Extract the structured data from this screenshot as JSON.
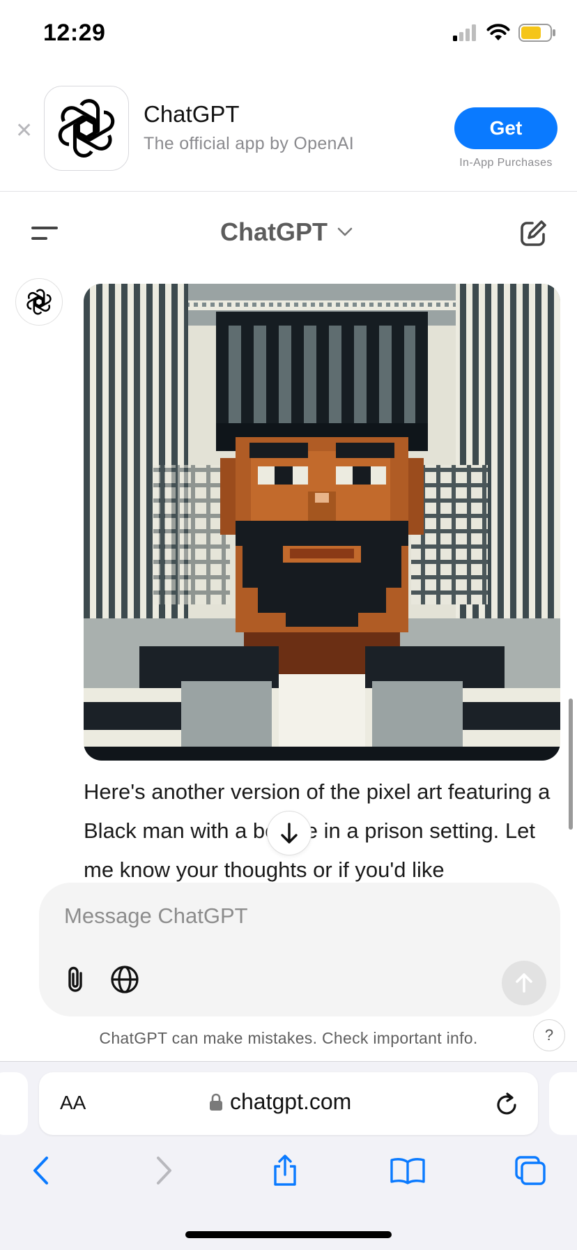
{
  "status_bar": {
    "time": "12:29",
    "signal_icon": "cellular-signal-icon",
    "wifi_icon": "wifi-icon",
    "battery_icon": "battery-icon",
    "battery_color": "#f5c518"
  },
  "app_banner": {
    "app_name": "ChatGPT",
    "subtitle": "The official app by OpenAI",
    "get_label": "Get",
    "in_app_label": "In-App Purchases",
    "accent_color": "#0a7aff"
  },
  "chat_header": {
    "title": "ChatGPT"
  },
  "conversation": {
    "assistant_text": "Here's another version of the pixel art featuring a Black man with a beanie in a prison setting. Let me know your thoughts or if you'd like"
  },
  "composer": {
    "placeholder": "Message ChatGPT",
    "disclaimer": "ChatGPT can make mistakes. Check important info.",
    "help_label": "?"
  },
  "safari": {
    "text_size_label": "AA",
    "url": "chatgpt.com"
  }
}
